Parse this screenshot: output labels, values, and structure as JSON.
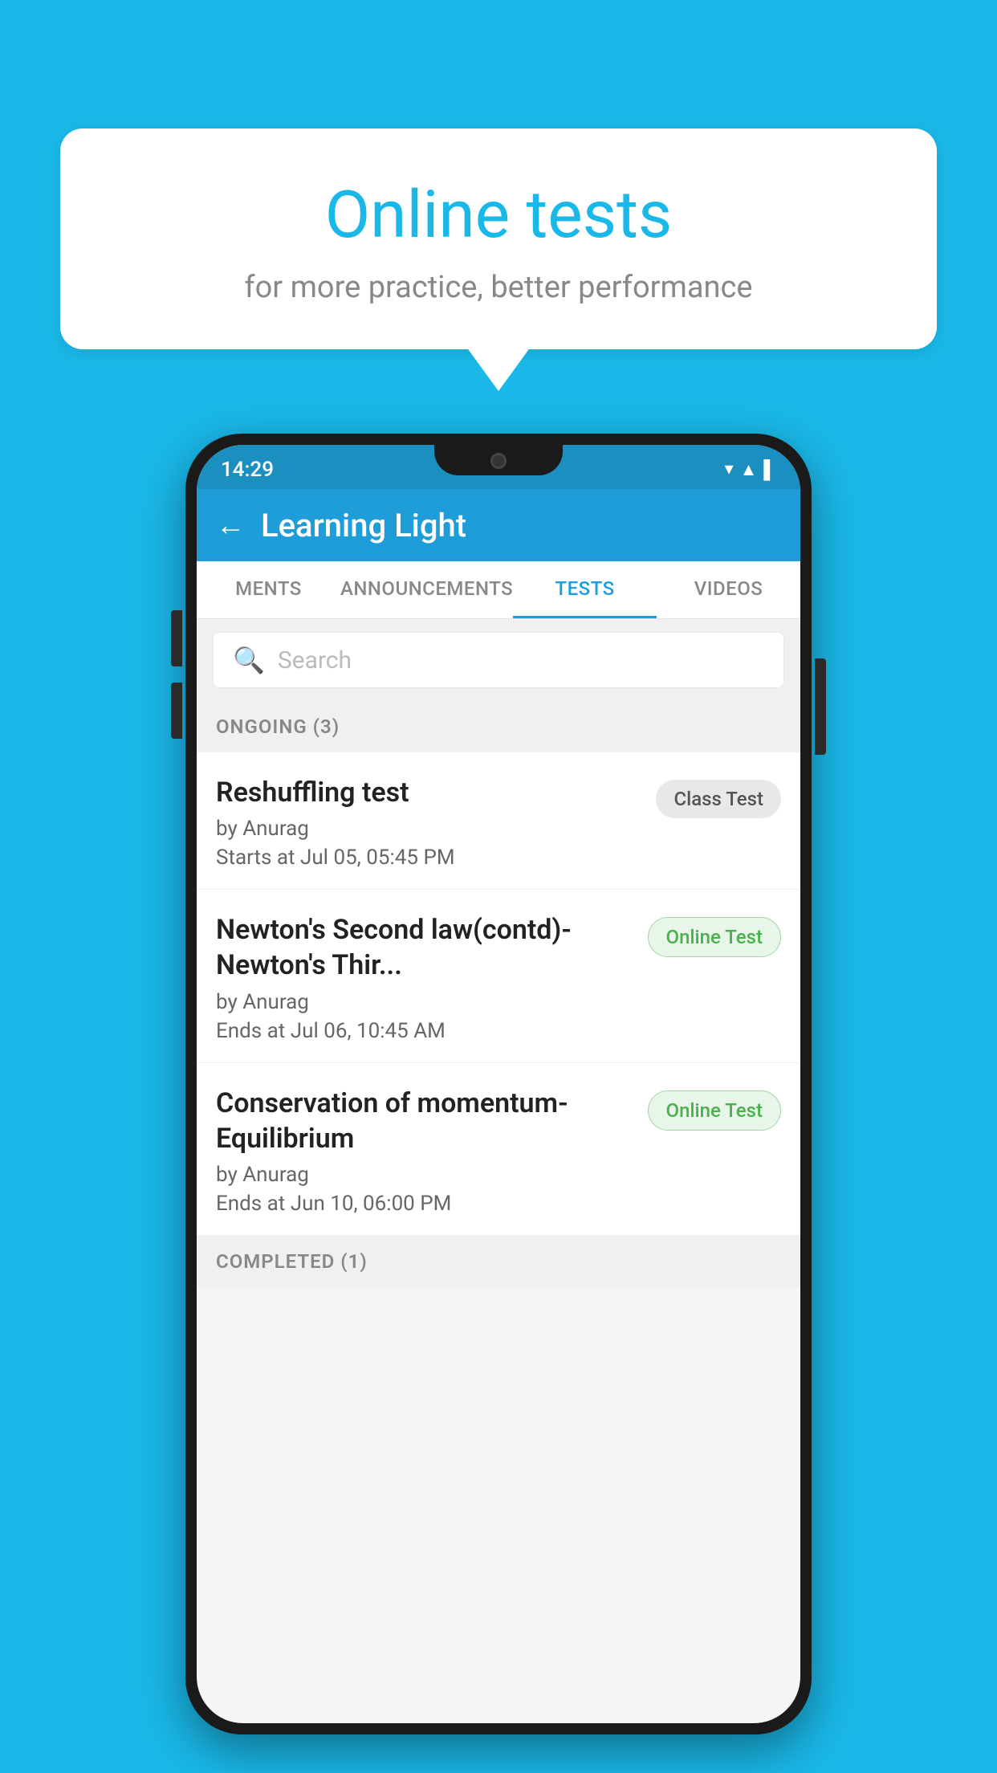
{
  "background_color": "#1ab8e8",
  "speech_bubble": {
    "title": "Online tests",
    "subtitle": "for more practice, better performance"
  },
  "phone": {
    "status_bar": {
      "time": "14:29",
      "icons": [
        "wifi",
        "signal",
        "battery"
      ]
    },
    "header": {
      "title": "Learning Light",
      "back_label": "←"
    },
    "tabs": [
      {
        "label": "MENTS",
        "active": false
      },
      {
        "label": "ANNOUNCEMENTS",
        "active": false
      },
      {
        "label": "TESTS",
        "active": true
      },
      {
        "label": "VIDEOS",
        "active": false
      }
    ],
    "search": {
      "placeholder": "Search"
    },
    "sections": [
      {
        "header": "ONGOING (3)",
        "items": [
          {
            "name": "Reshuffling test",
            "author": "by Anurag",
            "date": "Starts at  Jul 05, 05:45 PM",
            "badge": "Class Test",
            "badge_type": "class"
          },
          {
            "name": "Newton's Second law(contd)-Newton's Thir...",
            "author": "by Anurag",
            "date": "Ends at  Jul 06, 10:45 AM",
            "badge": "Online Test",
            "badge_type": "online"
          },
          {
            "name": "Conservation of momentum-Equilibrium",
            "author": "by Anurag",
            "date": "Ends at  Jun 10, 06:00 PM",
            "badge": "Online Test",
            "badge_type": "online"
          }
        ]
      }
    ],
    "completed_section": "COMPLETED (1)"
  }
}
